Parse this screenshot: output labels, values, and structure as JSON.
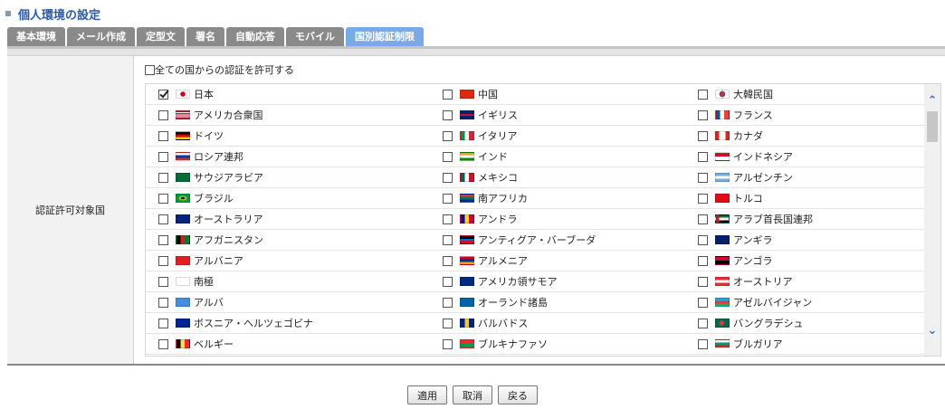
{
  "page": {
    "title": "個人環境の設定"
  },
  "tabs": [
    {
      "label": "基本環境",
      "active": false
    },
    {
      "label": "メール作成",
      "active": false
    },
    {
      "label": "定型文",
      "active": false
    },
    {
      "label": "署名",
      "active": false
    },
    {
      "label": "自動応答",
      "active": false
    },
    {
      "label": "モバイル",
      "active": false
    },
    {
      "label": "国別認証制限",
      "active": true
    }
  ],
  "form": {
    "field_label": "認証許可対象国",
    "allow_all": {
      "label": "全ての国からの認証を許可する",
      "checked": false
    }
  },
  "countries": [
    [
      {
        "name": "日本",
        "checked": true,
        "flag": "jp"
      },
      {
        "name": "中国",
        "checked": false,
        "flag": "cn"
      },
      {
        "name": "大韓民国",
        "checked": false,
        "flag": "kr"
      }
    ],
    [
      {
        "name": "アメリカ合衆国",
        "checked": false,
        "flag": "us"
      },
      {
        "name": "イギリス",
        "checked": false,
        "flag": "gb"
      },
      {
        "name": "フランス",
        "checked": false,
        "flag": "fr"
      }
    ],
    [
      {
        "name": "ドイツ",
        "checked": false,
        "flag": "de"
      },
      {
        "name": "イタリア",
        "checked": false,
        "flag": "it"
      },
      {
        "name": "カナダ",
        "checked": false,
        "flag": "ca"
      }
    ],
    [
      {
        "name": "ロシア連邦",
        "checked": false,
        "flag": "ru"
      },
      {
        "name": "インド",
        "checked": false,
        "flag": "in"
      },
      {
        "name": "インドネシア",
        "checked": false,
        "flag": "id"
      }
    ],
    [
      {
        "name": "サウジアラビア",
        "checked": false,
        "flag": "sa"
      },
      {
        "name": "メキシコ",
        "checked": false,
        "flag": "mx"
      },
      {
        "name": "アルゼンチン",
        "checked": false,
        "flag": "ar"
      }
    ],
    [
      {
        "name": "ブラジル",
        "checked": false,
        "flag": "br"
      },
      {
        "name": "南アフリカ",
        "checked": false,
        "flag": "za"
      },
      {
        "name": "トルコ",
        "checked": false,
        "flag": "tr"
      }
    ],
    [
      {
        "name": "オーストラリア",
        "checked": false,
        "flag": "au"
      },
      {
        "name": "アンドラ",
        "checked": false,
        "flag": "ad"
      },
      {
        "name": "アラブ首長国連邦",
        "checked": false,
        "flag": "ae"
      }
    ],
    [
      {
        "name": "アフガニスタン",
        "checked": false,
        "flag": "af"
      },
      {
        "name": "アンティグア・バーブーダ",
        "checked": false,
        "flag": "ag"
      },
      {
        "name": "アンギラ",
        "checked": false,
        "flag": "ai"
      }
    ],
    [
      {
        "name": "アルバニア",
        "checked": false,
        "flag": "al"
      },
      {
        "name": "アルメニア",
        "checked": false,
        "flag": "am"
      },
      {
        "name": "アンゴラ",
        "checked": false,
        "flag": "ao"
      }
    ],
    [
      {
        "name": "南極",
        "checked": false,
        "flag": "aq"
      },
      {
        "name": "アメリカ領サモア",
        "checked": false,
        "flag": "as"
      },
      {
        "name": "オーストリア",
        "checked": false,
        "flag": "at"
      }
    ],
    [
      {
        "name": "アルバ",
        "checked": false,
        "flag": "aw"
      },
      {
        "name": "オーランド諸島",
        "checked": false,
        "flag": "ax"
      },
      {
        "name": "アゼルバイジャン",
        "checked": false,
        "flag": "az"
      }
    ],
    [
      {
        "name": "ボスニア・ヘルツェゴビナ",
        "checked": false,
        "flag": "ba"
      },
      {
        "name": "バルバドス",
        "checked": false,
        "flag": "bb"
      },
      {
        "name": "バングラデシュ",
        "checked": false,
        "flag": "bd"
      }
    ],
    [
      {
        "name": "ベルギー",
        "checked": false,
        "flag": "be"
      },
      {
        "name": "ブルキナファソ",
        "checked": false,
        "flag": "bf"
      },
      {
        "name": "ブルガリア",
        "checked": false,
        "flag": "bg"
      }
    ]
  ],
  "buttons": {
    "apply": "適用",
    "cancel": "取消",
    "back": "戻る"
  }
}
